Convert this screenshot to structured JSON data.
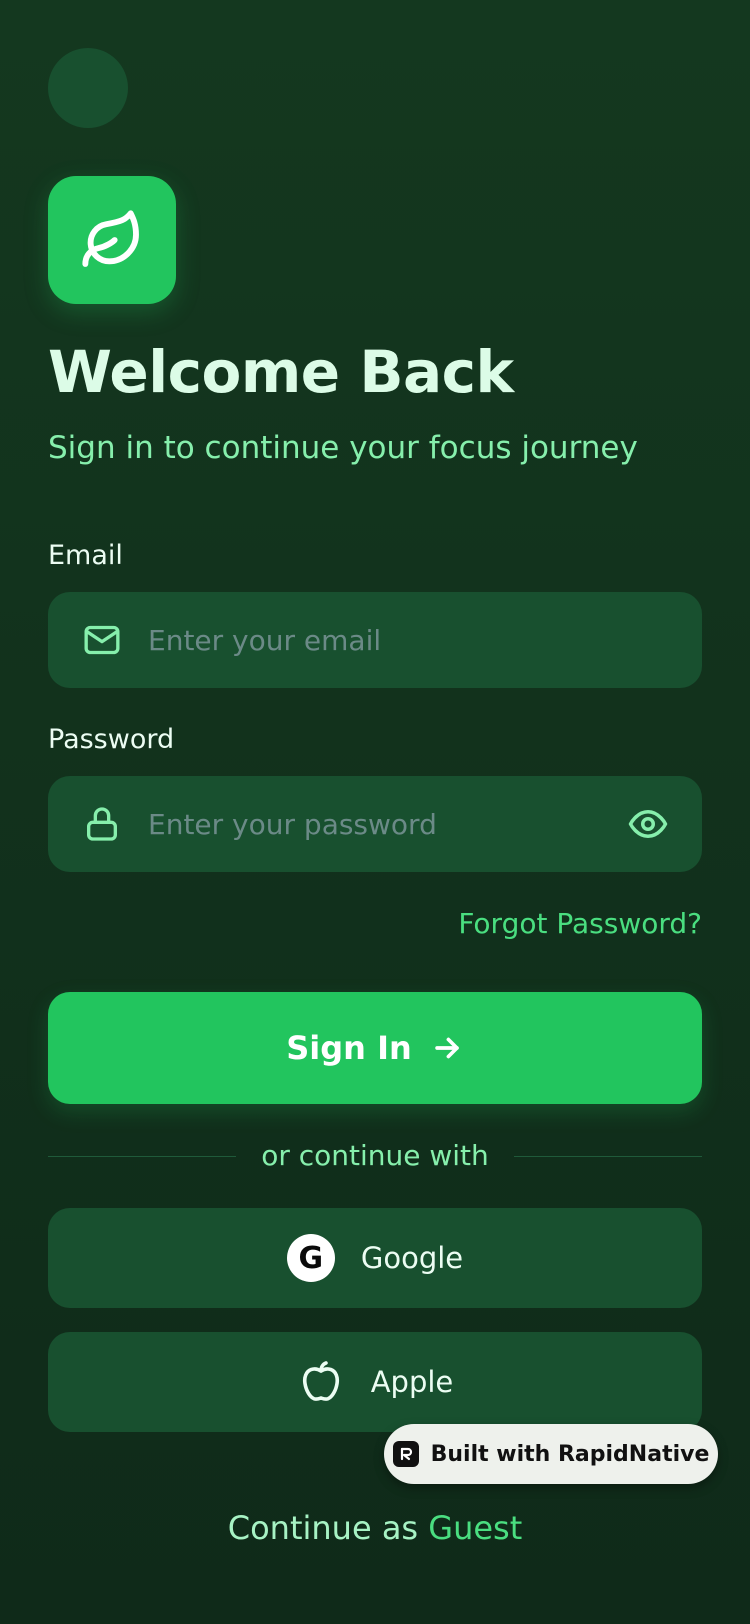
{
  "header": {
    "title": "Welcome Back",
    "subtitle": "Sign in to continue your focus journey"
  },
  "form": {
    "email_label": "Email",
    "email_placeholder": "Enter your email",
    "email_value": "",
    "password_label": "Password",
    "password_placeholder": "Enter your password",
    "password_value": "",
    "forgot_label": "Forgot Password?",
    "signin_label": "Sign In"
  },
  "social": {
    "divider_label": "or continue with",
    "google_glyph": "G",
    "google_label": "Google",
    "apple_label": "Apple"
  },
  "badge": {
    "label": "Built with RapidNative"
  },
  "guest": {
    "prefix": "Continue as",
    "link": "Guest"
  },
  "icons": {
    "logo": "leaf-icon",
    "email": "mail-icon",
    "password": "lock-icon",
    "visibility": "eye-icon",
    "signin": "arrow-right-icon",
    "apple": "apple-icon"
  },
  "colors": {
    "background": "#14381f",
    "accent": "#22c55e",
    "surface": "#18502f",
    "link": "#4ade80"
  }
}
